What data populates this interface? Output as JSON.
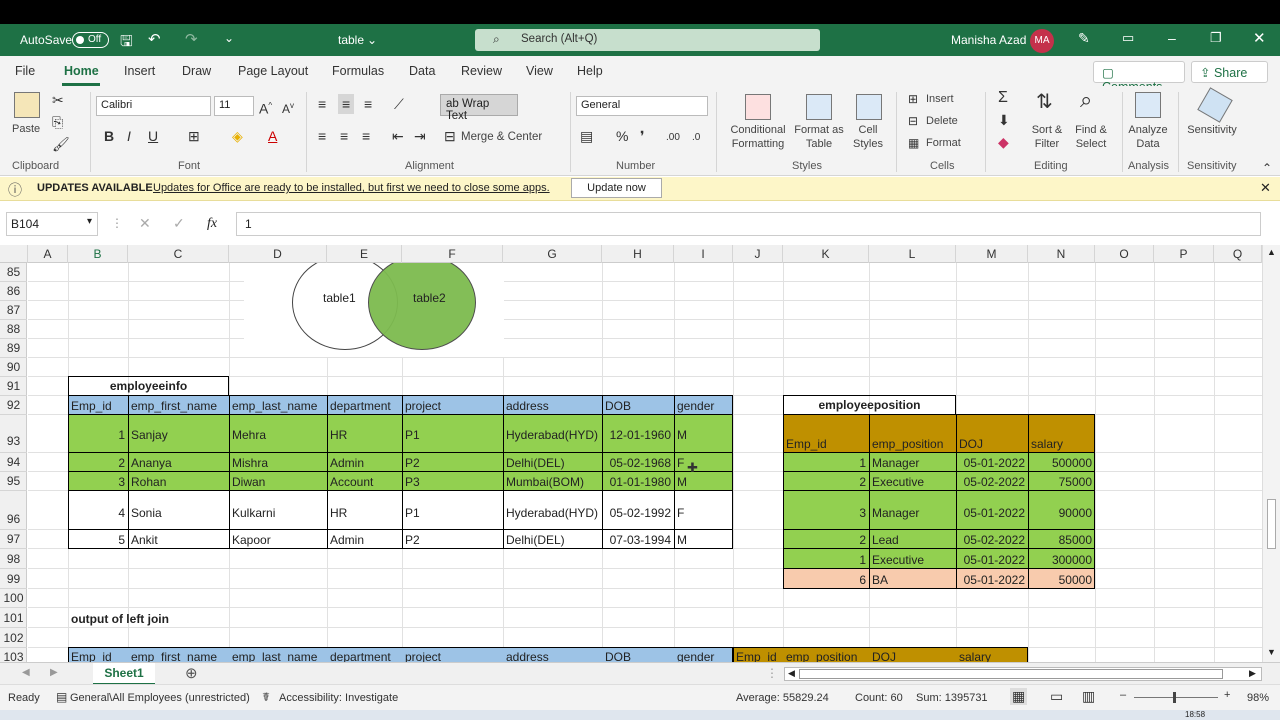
{
  "titlebar": {
    "autosave": "AutoSave",
    "autosave_state": "Off",
    "filename": "table",
    "search_placeholder": "Search (Alt+Q)",
    "user": "Manisha Azad",
    "initials": "MA"
  },
  "tabs": [
    "File",
    "Home",
    "Insert",
    "Draw",
    "Page Layout",
    "Formulas",
    "Data",
    "Review",
    "View",
    "Help"
  ],
  "comments": "Comments",
  "share": "Share",
  "ribbon": {
    "clipboard": {
      "paste": "Paste",
      "label": "Clipboard"
    },
    "font": {
      "name": "Calibri",
      "size": "11",
      "label": "Font"
    },
    "alignment": {
      "wrap": "Wrap Text",
      "merge": "Merge & Center",
      "label": "Alignment"
    },
    "number": {
      "format": "General",
      "label": "Number"
    },
    "styles": {
      "cond1": "Conditional",
      "cond2": "Formatting",
      "fmt1": "Format as",
      "fmt2": "Table",
      "cell1": "Cell",
      "cell2": "Styles",
      "label": "Styles"
    },
    "cells": {
      "insert": "Insert",
      "delete": "Delete",
      "format": "Format",
      "label": "Cells"
    },
    "editing": {
      "sort1": "Sort &",
      "sort2": "Filter",
      "find1": "Find &",
      "find2": "Select",
      "label": "Editing"
    },
    "analysis": {
      "a1": "Analyze",
      "a2": "Data",
      "label": "Analysis"
    },
    "sensitivity": {
      "s1": "Sensitivity",
      "label": "Sensitivity"
    }
  },
  "infobar": {
    "title": "UPDATES AVAILABLE",
    "message": "Updates for Office are ready to be installed, but first we need to close some apps.",
    "button": "Update now"
  },
  "formula": {
    "namebox": "B104",
    "fx": "fx",
    "value": "1"
  },
  "columns": [
    "A",
    "B",
    "C",
    "D",
    "E",
    "F",
    "G",
    "H",
    "I",
    "J",
    "K",
    "L",
    "M",
    "N",
    "O",
    "P",
    "Q"
  ],
  "rows": [
    "85",
    "86",
    "87",
    "88",
    "89",
    "90",
    "91",
    "92",
    "93",
    "94",
    "95",
    "96",
    "97",
    "98",
    "99",
    "100",
    "101",
    "102",
    "103"
  ],
  "venn": {
    "left": "table1",
    "right": "table2"
  },
  "employeeinfo": {
    "title": "employeeinfo",
    "headers": [
      "Emp_id",
      "emp_first_name",
      "emp_last_name",
      "department",
      "project",
      "address",
      "DOB",
      "gender"
    ],
    "rows": [
      [
        "1",
        "Sanjay",
        "Mehra",
        "HR",
        "P1",
        "Hyderabad(HYD)",
        "12-01-1960",
        "M"
      ],
      [
        "2",
        "Ananya",
        "Mishra",
        "Admin",
        "P2",
        "Delhi(DEL)",
        "05-02-1968",
        "F"
      ],
      [
        "3",
        "Rohan",
        "Diwan",
        "Account",
        "P3",
        "Mumbai(BOM)",
        "01-01-1980",
        "M"
      ],
      [
        "4",
        "Sonia",
        "Kulkarni",
        "HR",
        "P1",
        "Hyderabad(HYD)",
        "05-02-1992",
        "F"
      ],
      [
        "5",
        "Ankit",
        "Kapoor",
        "Admin",
        "P2",
        "Delhi(DEL)",
        "07-03-1994",
        "M"
      ]
    ]
  },
  "employeeposition": {
    "title": "employeeposition",
    "headers": [
      "Emp_id",
      "emp_position",
      "DOJ",
      "salary"
    ],
    "rows": [
      [
        "1",
        "Manager",
        "05-01-2022",
        "500000"
      ],
      [
        "2",
        "Executive",
        "05-02-2022",
        "75000"
      ],
      [
        "3",
        "Manager",
        "05-01-2022",
        "90000"
      ],
      [
        "2",
        "Lead",
        "05-02-2022",
        "85000"
      ],
      [
        "1",
        "Executive",
        "05-01-2022",
        "300000"
      ],
      [
        "6",
        "BA",
        "05-01-2022",
        "50000"
      ]
    ]
  },
  "output_label": "output of left join",
  "join_headers": [
    "Emp_id",
    "emp_first_name",
    "emp_last_name",
    "department",
    "project",
    "address",
    "DOB",
    "gender",
    "Emp_id",
    "emp_position",
    "DOJ",
    "salary"
  ],
  "sheet": "Sheet1",
  "status": {
    "ready": "Ready",
    "sensitivity": "General\\All Employees (unrestricted)",
    "accessibility": "Accessibility: Investigate",
    "average": "Average: 55829.24",
    "count": "Count: 60",
    "sum": "Sum: 1395731",
    "zoom": "98%"
  },
  "clock": "18:58",
  "colors": {
    "excel_green": "#1e7145",
    "header_blue": "#9dc3e6",
    "row_green": "#92d050",
    "gold": "#bf9000",
    "peach": "#f8cbad"
  }
}
